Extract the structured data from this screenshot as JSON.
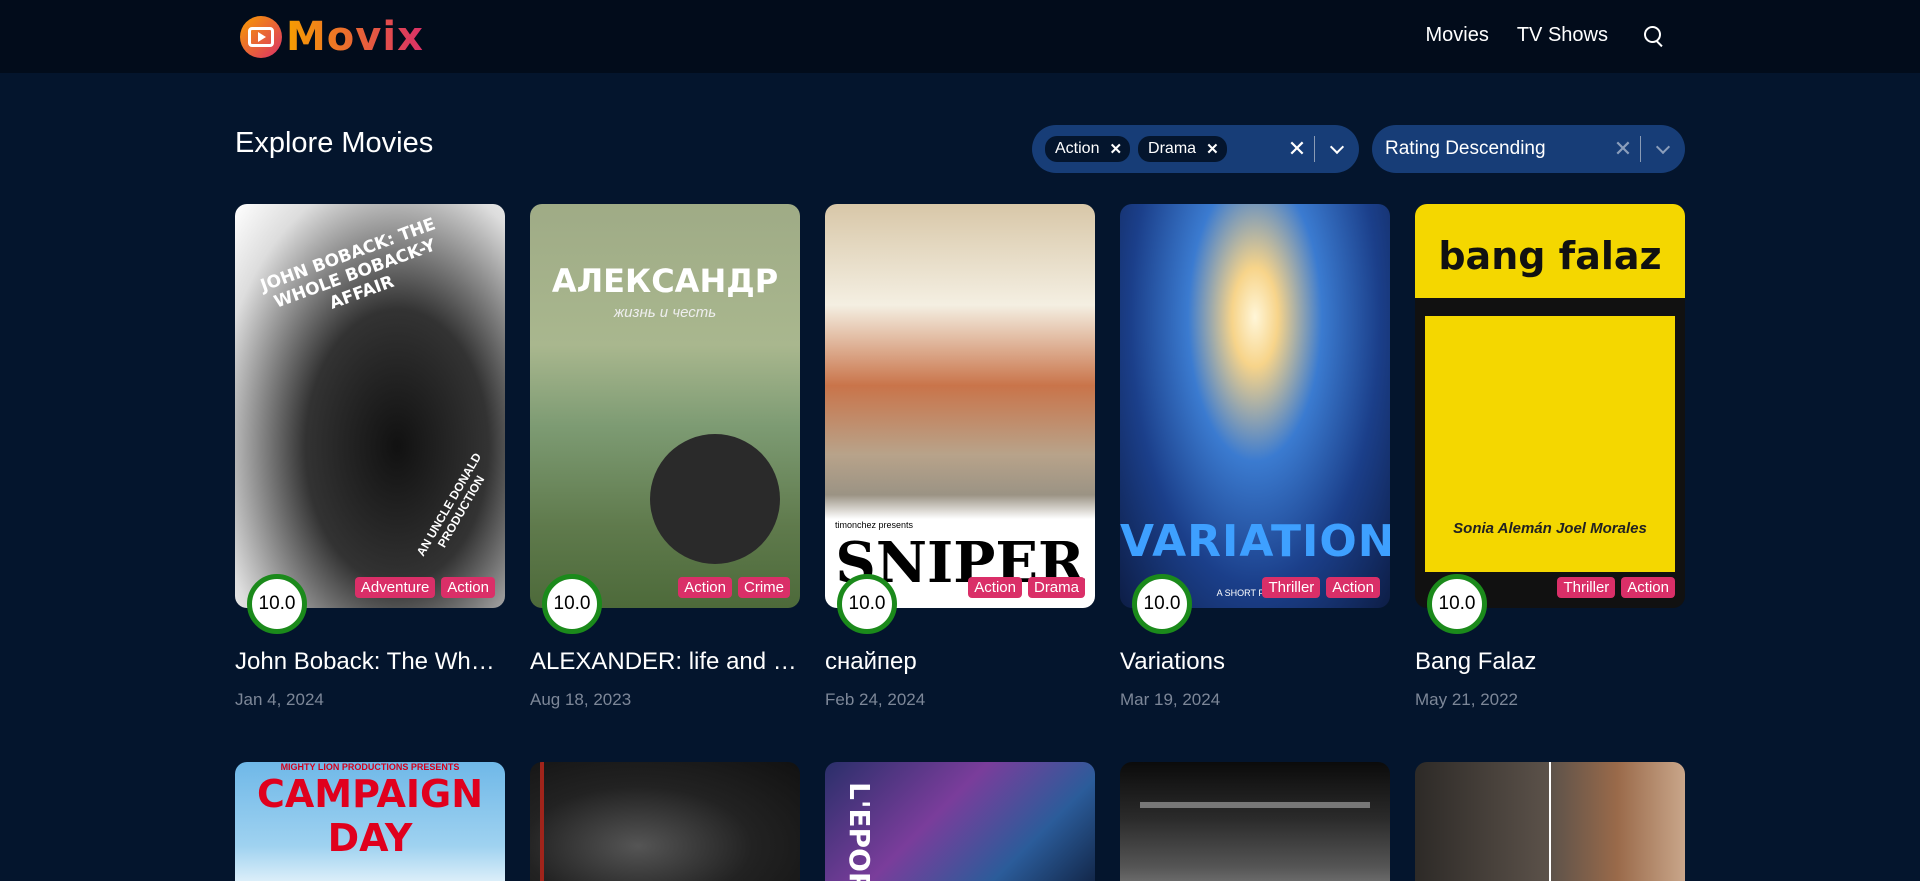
{
  "app": {
    "logo_text": "Movix"
  },
  "nav": {
    "movies": "Movies",
    "tv_shows": "TV Shows"
  },
  "page": {
    "title": "Explore Movies"
  },
  "genre_filter": {
    "chips": [
      "Action",
      "Drama"
    ]
  },
  "sort_filter": {
    "value": "Rating Descending"
  },
  "movies": [
    {
      "title": "John Boback: The Whole Boback-y Affair",
      "date": "Jan 4, 2024",
      "rating": "10.0",
      "genres": [
        "Adventure",
        "Action"
      ],
      "poster_text": "JOHN BOBACK: THE WHOLE BOBACK-Y AFFAIR",
      "poster_sub": "AN UNCLE DONALD PRODUCTION"
    },
    {
      "title": "ALEXANDER: life and honor",
      "date": "Aug 18, 2023",
      "rating": "10.0",
      "genres": [
        "Action",
        "Crime"
      ],
      "poster_text": "АЛЕКСАНДР",
      "poster_sub": "жизнь и честь"
    },
    {
      "title": "снайпер",
      "date": "Feb 24, 2024",
      "rating": "10.0",
      "genres": [
        "Action",
        "Drama"
      ],
      "poster_text": "SNIPER",
      "poster_sub": "timonchez presents"
    },
    {
      "title": "Variations",
      "date": "Mar 19, 2024",
      "rating": "10.0",
      "genres": [
        "Thriller",
        "Action"
      ],
      "poster_text": "VARIATIONS",
      "poster_sub": "A SHORT FILM BY"
    },
    {
      "title": "Bang Falaz",
      "date": "May 21, 2022",
      "rating": "10.0",
      "genres": [
        "Thriller",
        "Action"
      ],
      "poster_text": "bang falaz",
      "poster_sub": "Sonia Alemán   Joel Morales"
    }
  ],
  "row2": [
    {
      "poster_text": "CAMPAIGN DAY",
      "poster_sub": "MIGHTY LION PRODUCTIONS PRESENTS"
    },
    {
      "poster_text": ""
    },
    {
      "poster_text": "L'EPOP"
    },
    {
      "poster_text": ""
    },
    {
      "poster_text": ""
    }
  ]
}
